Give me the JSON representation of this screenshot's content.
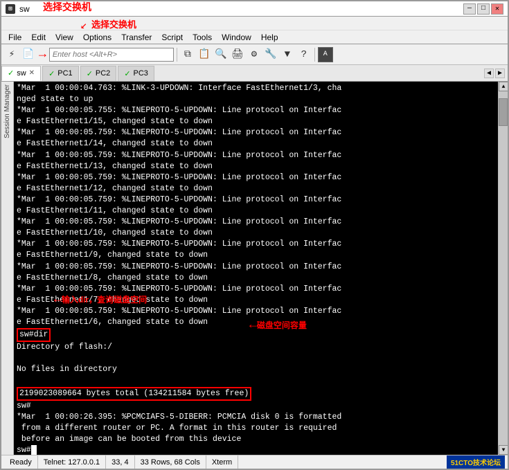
{
  "window": {
    "title": "sw",
    "icon_label": "sw"
  },
  "title_controls": {
    "minimize": "—",
    "maximize": "□",
    "close": "✕"
  },
  "menu": {
    "items": [
      "File",
      "Edit",
      "View",
      "Options",
      "Transfer",
      "Script",
      "Tools",
      "Window",
      "Help"
    ]
  },
  "toolbar": {
    "host_placeholder": "Enter host <Alt+R>"
  },
  "tabs": [
    {
      "label": "sw",
      "active": true,
      "closeable": true
    },
    {
      "label": "PC1",
      "active": false,
      "closeable": false
    },
    {
      "label": "PC2",
      "active": false,
      "closeable": false
    },
    {
      "label": "PC3",
      "active": false,
      "closeable": false
    }
  ],
  "session_manager_label": "Session Manager",
  "terminal_lines": [
    "*Mar  1 00:00:04.763: %LINK-3-UPDOWN: Interface FastEthernet1/3, cha",
    "nged state to up",
    "*Mar  1 00:00:05.755: %LINEPROTO-5-UPDOWN: Line protocol on Interfac",
    "e FastEthernet1/15, changed state to down",
    "*Mar  1 00:00:05.759: %LINEPROTO-5-UPDOWN: Line protocol on Interfac",
    "e FastEthernet1/14, changed state to down",
    "*Mar  1 00:00:05.759: %LINEPROTO-5-UPDOWN: Line protocol on Interfac",
    "e FastEthernet1/13, changed state to down",
    "*Mar  1 00:00:05.759: %LINEPROTO-5-UPDOWN: Line protocol on Interfac",
    "e FastEthernet1/12, changed state to down",
    "*Mar  1 00:00:05.759: %LINEPROTO-5-UPDOWN: Line protocol on Interfac",
    "e FastEthernet1/11, changed state to down",
    "*Mar  1 00:00:05.759: %LINEPROTO-5-UPDOWN: Line protocol on Interfac",
    "e FastEthernet1/10, changed state to down",
    "*Mar  1 00:00:05.759: %LINEPROTO-5-UPDOWN: Line protocol on Interfac",
    "e FastEthernet1/9, changed state to down",
    "*Mar  1 00:00:05.759: %LINEPROTO-5-UPDOWN: Line protocol on Interfac",
    "e FastEthernet1/8, changed state to down",
    "*Mar  1 00:00:05.759: %LINEPROTO-5-UPDOWN: Line protocol on Interfac",
    "e FastEthernet1/7, changed state to down",
    "*Mar  1 00:00:05.759: %LINEPROTO-5-UPDOWN: Line protocol on Interfac",
    "e FastEthernet1/6, changed state to down"
  ],
  "dir_command": "sw#dir",
  "dir_output": [
    "Directory of flash:/",
    "",
    "No files in directory",
    ""
  ],
  "disk_line": "2199023089664 bytes total (134211584 bytes free)",
  "post_dir_lines": [
    "sw#",
    "*Mar  1 00:00:26.395: %PCMCIAFS-5-DIBERR: PCMCIA disk 0 is formatted",
    " from a different router or PC. A format in this router is required",
    " before an image can be booted from this device",
    "sw#"
  ],
  "annotations": {
    "title_label": "选择交换机",
    "dir_label": "输入dir，查询磁盘空间",
    "disk_label": "磁盘空间容量"
  },
  "status_bar": {
    "ready": "Ready",
    "telnet": "Telnet: 127.0.0.1",
    "position": "33, 4",
    "dimensions": "33 Rows, 68 Cols",
    "terminal": "Xterm",
    "logo": "51CTO技术论坛"
  }
}
